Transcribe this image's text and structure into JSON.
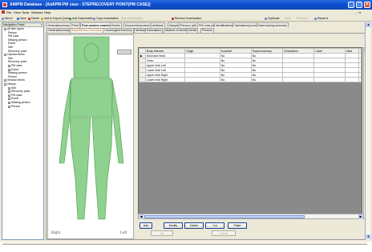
{
  "window": {
    "title": "AM/PM Database - [AdAPM-PM case - STEPRECOVERY POINT(PM CASE)]"
  },
  "menu": {
    "items": [
      "File",
      "View",
      "Tools",
      "Window",
      "Help"
    ],
    "mdi_controls": "_ ▫ ×"
  },
  "toolbar": {
    "items": [
      {
        "label": "New",
        "enabled": true
      },
      {
        "label": "Save",
        "enabled": true
      },
      {
        "label": "Delete",
        "enabled": true
      },
      {
        "label": "Add to Export Queue",
        "enabled": true
      },
      {
        "label": "Add Examination",
        "enabled": true
      },
      {
        "label": "Copy examination",
        "enabled": true
      },
      {
        "label": "Ante Examination",
        "enabled": false
      },
      {
        "label": "Remove Examination",
        "enabled": true
      },
      {
        "label": "Duplicate",
        "enabled": true
      },
      {
        "label": "Next",
        "enabled": false
      },
      {
        "label": "Previous",
        "enabled": false
      },
      {
        "label": "Report",
        "enabled": true
      }
    ]
  },
  "navigation": {
    "title": "Navigation Panel",
    "close": "×",
    "tree": [
      {
        "label": "All item types",
        "level": 0,
        "expander": "−"
      },
      {
        "label": "Person",
        "level": 1
      },
      {
        "label": "PM case",
        "level": 1
      },
      {
        "label": "Missing person",
        "level": 1
      },
      {
        "label": "Event",
        "level": 1
      },
      {
        "label": "Site",
        "level": 1
      },
      {
        "label": "Recovery point",
        "level": 1
      },
      {
        "label": "Opened items",
        "level": 0,
        "expander": "−"
      },
      {
        "label": "Site",
        "level": 1
      },
      {
        "label": "Recovery point",
        "level": 1
      },
      {
        "label": "PM case",
        "level": 1,
        "expander": "+"
      },
      {
        "label": "Event",
        "level": 1,
        "expander": "+"
      },
      {
        "label": "Missing person",
        "level": 1
      },
      {
        "label": "Person",
        "level": 1
      },
      {
        "label": "Session items",
        "level": 0,
        "expander": "+"
      },
      {
        "label": "History",
        "level": 0,
        "expander": "−"
      },
      {
        "label": "Site",
        "level": 1,
        "expander": "+"
      },
      {
        "label": "Recovery point",
        "level": 1,
        "expander": "+"
      },
      {
        "label": "PM case",
        "level": 1,
        "expander": "+"
      },
      {
        "label": "Event",
        "level": 1,
        "expander": "+"
      },
      {
        "label": "Missing person",
        "level": 1,
        "expander": "+"
      },
      {
        "label": "Person",
        "level": 1,
        "expander": "+"
      }
    ]
  },
  "main_tabs": {
    "items": [
      "General/summary",
      "Field",
      "Post-mortem examination",
      "Events",
      "Documents/photos/videos",
      "Artefacts",
      "Samples",
      "Persons (all)",
      "PM Links (all)",
      "Identifications",
      "Operations/journal",
      "Data tracking summary"
    ],
    "active": 2
  },
  "sub_tabs": {
    "items": [
      "General/summary",
      "Body/Skeleton inventory",
      "Commingled inventory",
      "Medical",
      "Estimations",
      "Markers of identity",
      "Dental",
      "Persons"
    ],
    "active": 1
  },
  "body_diagram": {
    "left_label": "Right",
    "right_label": "Left",
    "button_label": "Inventory",
    "fill_color": "#8fd18f",
    "stroke_color": "#4a9a4a"
  },
  "grid": {
    "columns": [
      "Body element",
      "Origin",
      "Is partial",
      "Supernumerary",
      "Description",
      "Label",
      "Mea"
    ],
    "rows": [
      [
        "Skull and Neck",
        "",
        "No",
        "No",
        "",
        "",
        ""
      ],
      [
        "Torso",
        "",
        "No",
        "No",
        "",
        "",
        ""
      ],
      [
        "Upper limb Left",
        "",
        "No",
        "No",
        "",
        "",
        ""
      ],
      [
        "Lower limb Left",
        "",
        "No",
        "No",
        "",
        "",
        ""
      ],
      [
        "Upper limb Right",
        "",
        "No",
        "No",
        "",
        "",
        ""
      ],
      [
        "Lower limb Right",
        "",
        "No",
        "No",
        "",
        "",
        ""
      ]
    ],
    "current_row_marker": "▶"
  },
  "actions": {
    "add": "Add",
    "modify": "Modify",
    "delete": "Delete",
    "cut": "Cut",
    "paste": "Paste",
    "ok": "Ok",
    "cancel": "Cancel"
  },
  "scroll": {
    "up": "▲",
    "down": "▼",
    "left": "◀",
    "right": "▶"
  }
}
